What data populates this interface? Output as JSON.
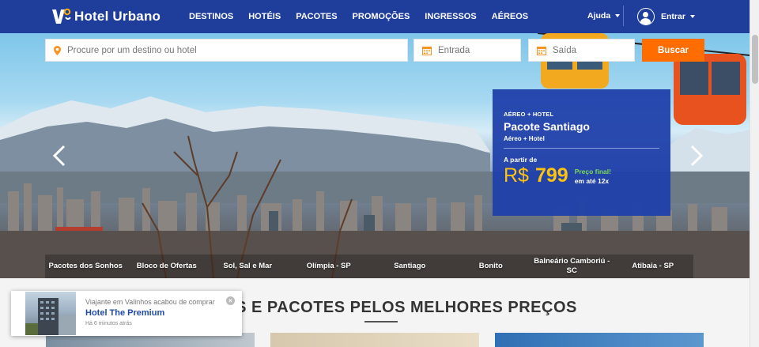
{
  "brand": {
    "name": "Hotel Urbano"
  },
  "nav": {
    "items": [
      "DESTINOS",
      "HOTÉIS",
      "PACOTES",
      "PROMOÇÕES",
      "INGRESSOS",
      "AÉREOS"
    ],
    "help_label": "Ajuda",
    "login_label": "Entrar"
  },
  "search": {
    "destination_placeholder": "Procure por um destino ou hotel",
    "checkin_placeholder": "Entrada",
    "checkout_placeholder": "Saída",
    "button_label": "Buscar"
  },
  "promo": {
    "kind": "AÉREO + HOTEL",
    "title": "Pacote Santiago",
    "subtitle": "Aéreo + Hotel",
    "from_label": "A partir de",
    "currency": "R$",
    "price": "799",
    "final_label": "Preço final!",
    "installments": "em até 12x"
  },
  "slider_tabs": [
    "Pacotes dos Sonhos",
    "Bloco de Ofertas",
    "Sol, Sal e Mar",
    "Olímpia - SP",
    "Santiago",
    "Bonito",
    "Balneário Camboriú - SC",
    "Atibaia - SP"
  ],
  "section": {
    "title": "S E PACOTES PELOS MELHORES PREÇOS"
  },
  "toast": {
    "line1": "Viajante em Valinhos acabou de comprar",
    "hotel": "Hotel The Premium",
    "time": "Há 6 minutos atrás",
    "close": "×"
  },
  "colors": {
    "header_bg": "#1f3e9c",
    "accent_orange": "#ff6d00",
    "price_yellow": "#ffc20e",
    "final_green": "#7ed957"
  }
}
